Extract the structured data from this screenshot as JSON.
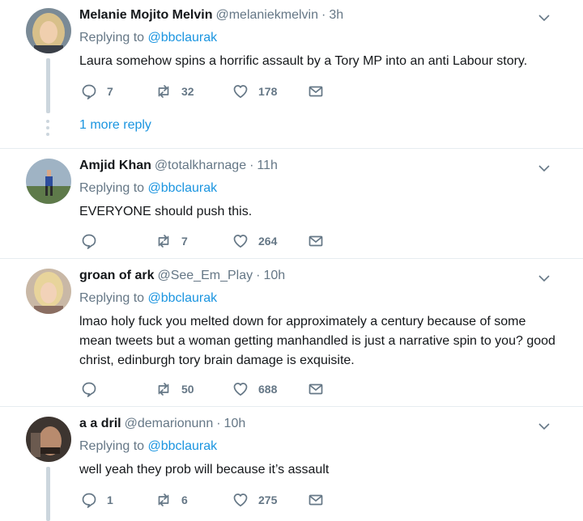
{
  "tweets": [
    {
      "name": "Melanie Mojito Melvin",
      "handle": "@melaniekmelvin",
      "dot": "·",
      "time": "3h",
      "replying_prefix": "Replying to",
      "replying_to": "@bbclaurak",
      "text": "Laura somehow spins a horrific assault by a Tory MP into an anti Labour story.",
      "replies": "7",
      "retweets": "32",
      "likes": "178",
      "more_reply": "1 more reply"
    },
    {
      "name": "Amjid Khan",
      "handle": "@totalkharnage",
      "dot": "·",
      "time": "11h",
      "replying_prefix": "Replying to",
      "replying_to": "@bbclaurak",
      "text": "EVERYONE should push this.",
      "replies": "",
      "retweets": "7",
      "likes": "264"
    },
    {
      "name": "groan of ark",
      "handle": "@See_Em_Play",
      "dot": "·",
      "time": "10h",
      "replying_prefix": "Replying to",
      "replying_to": "",
      "text": "lmao holy fuck you melted down for approximately a century because of some mean tweets but a woman getting manhandled is just a narrative spin to you? good christ, edinburgh tory brain damage is exquisite.",
      "replies": "",
      "retweets": "50",
      "likes": "688"
    },
    {
      "name": "a a dril",
      "handle": "@demarionunn",
      "dot": "·",
      "time": "10h",
      "replying_prefix": "Replying to",
      "replying_to": "@bbclaurak",
      "text": "well yeah they prob will because it’s assault",
      "replies": "1",
      "retweets": "6",
      "likes": "275"
    }
  ],
  "icons": {
    "reply": "reply-icon",
    "retweet": "retweet-icon",
    "like": "heart-icon",
    "dm": "envelope-icon",
    "caret": "chevron-down-icon"
  },
  "colors": {
    "link": "#1b95e0",
    "secondary": "#657786",
    "text": "#14171a",
    "divider": "#e6ecf0",
    "thread": "#ccd6dd"
  }
}
